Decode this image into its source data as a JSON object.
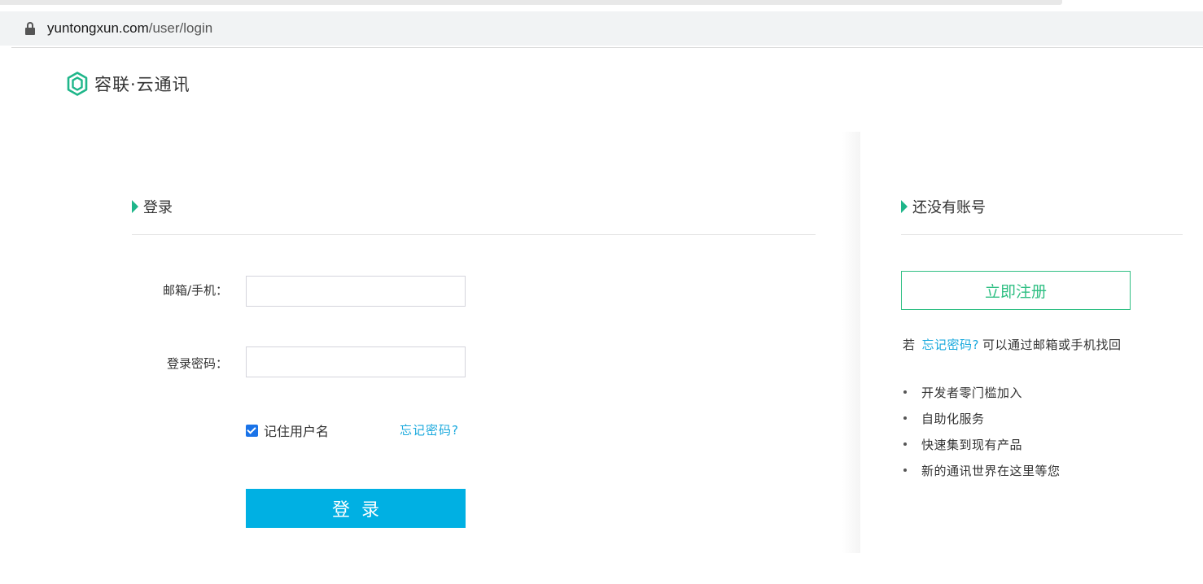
{
  "browser": {
    "url_host": "yuntongxun.com",
    "url_path": "/user/login"
  },
  "logo": {
    "text": "容联·云通讯",
    "icon": "hexagon-logo-icon",
    "color": "#1fb68a"
  },
  "login": {
    "title": "登录",
    "email_label": "邮箱/手机：",
    "email_value": "",
    "password_label": "登录密码：",
    "password_value": "",
    "remember_label": "记住用户名",
    "remember_checked": true,
    "forgot_label": "忘记密码?",
    "submit_label": "登录"
  },
  "signup": {
    "title": "还没有账号",
    "register_label": "立即注册",
    "hint_prefix": "若",
    "hint_link": "忘记密码?",
    "hint_suffix": "可以通过邮箱或手机找回",
    "benefits": [
      "开发者零门槛加入",
      "自助化服务",
      "快速集到现有产品",
      "新的通讯世界在这里等您"
    ]
  },
  "colors": {
    "accent_green": "#1fb68a",
    "register_green": "#2fbf83",
    "link_blue": "#1aa9dd",
    "button_blue": "#00b0e3"
  }
}
